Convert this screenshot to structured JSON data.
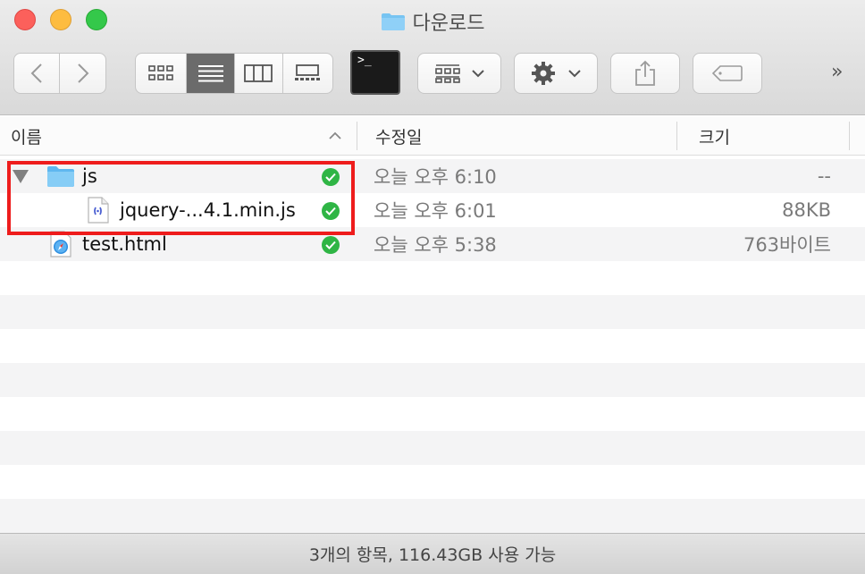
{
  "window": {
    "title": "다운로드",
    "traffic_lights": [
      "close",
      "minimize",
      "zoom"
    ]
  },
  "toolbar": {
    "back_icon": "chevron-left-icon",
    "forward_icon": "chevron-right-icon",
    "view_modes": [
      "icon-view",
      "list-view",
      "column-view",
      "gallery-view"
    ],
    "selected_view": "list-view",
    "terminal_prompt": ">_",
    "group_icon": "group-by-icon",
    "action_icon": "gear-icon",
    "share_icon": "share-icon",
    "tag_icon": "tag-icon",
    "more": "»"
  },
  "columns": {
    "name": "이름",
    "modified": "수정일",
    "size": "크기"
  },
  "files": [
    {
      "name": "js",
      "kind": "folder",
      "date": "오늘 오후 6:10",
      "size": "--",
      "synced": true,
      "expanded": true
    },
    {
      "name": "jquery-...4.1.min.js",
      "kind": "js-file",
      "date": "오늘 오후 6:01",
      "size": "88KB",
      "synced": true
    },
    {
      "name": "test.html",
      "kind": "html-file",
      "date": "오늘 오후 5:38",
      "size": "763바이트",
      "synced": true
    }
  ],
  "status": {
    "text": "3개의 항목, 116.43GB 사용 가능"
  },
  "colors": {
    "accent_check": "#2fb545",
    "highlight": "#ee1c1c",
    "folder_blue": "#6cc0f3"
  }
}
